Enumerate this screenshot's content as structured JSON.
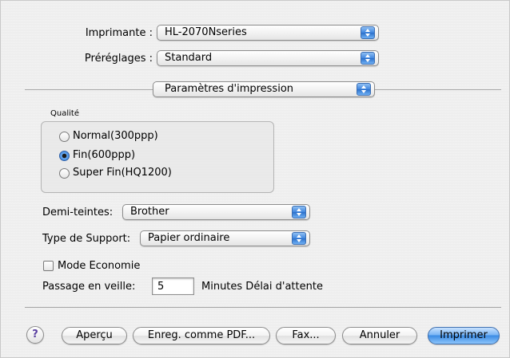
{
  "printer": {
    "label": "Imprimante :",
    "value": "HL-2070Nseries"
  },
  "presets": {
    "label": "Préréglages :",
    "value": "Standard"
  },
  "panel": {
    "value": "Paramètres d'impression"
  },
  "quality": {
    "title": "Qualité",
    "options": [
      {
        "label": "Normal(300ppp)",
        "selected": false
      },
      {
        "label": "Fin(600ppp)",
        "selected": true
      },
      {
        "label": "Super Fin(HQ1200)",
        "selected": false
      }
    ]
  },
  "halftone": {
    "label": "Demi-teintes:",
    "value": "Brother"
  },
  "media": {
    "label": "Type de Support:",
    "value": "Papier ordinaire"
  },
  "economy": {
    "label": "Mode Economie",
    "checked": false
  },
  "sleep": {
    "label": "Passage en veille:",
    "value": "5",
    "suffix": "Minutes Délai d'attente"
  },
  "buttons": {
    "help": "?",
    "preview": "Aperçu",
    "save_pdf": "Enreg. comme PDF...",
    "fax": "Fax...",
    "cancel": "Annuler",
    "print": "Imprimer"
  },
  "colors": {
    "accent": "#3b8be4",
    "window_bg": "#ececec"
  }
}
